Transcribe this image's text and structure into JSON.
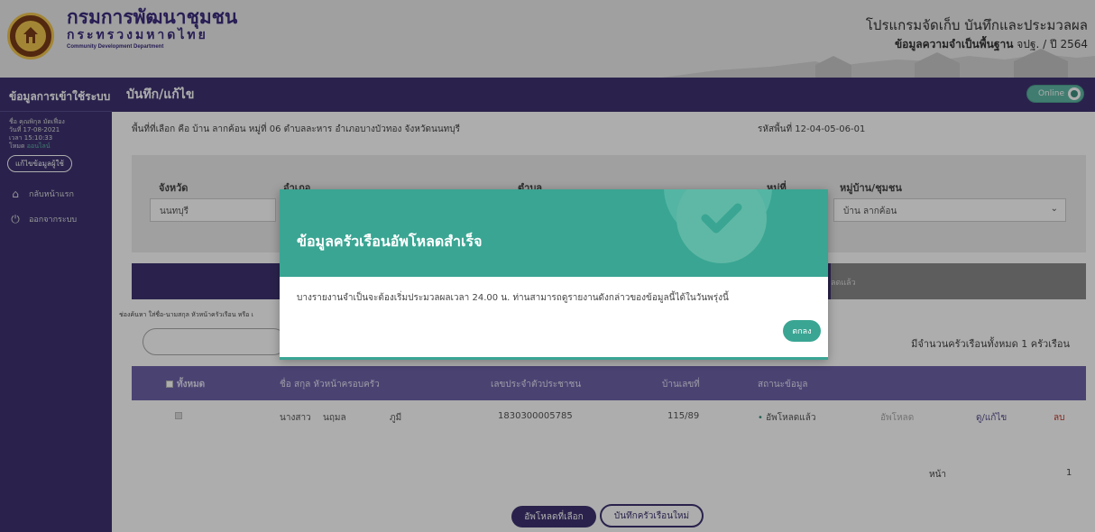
{
  "header": {
    "org_name_th": "กรมการพัฒนาชุมชน",
    "ministry_th": "กระทรวงมหาดไทย",
    "org_name_en": "Community Development Department",
    "program_title": "โปรแกรมจัดเก็บ บันทึกและประมวลผล",
    "program_sub_prefix": "ข้อมูลความจำเป็นพื้นฐาน",
    "program_sub_bold": "จปฐ. / ปี 2564"
  },
  "sidebar": {
    "title": "ข้อมูลการเข้าใช้ระบบ",
    "user_name": "ชื่อ คุณพิกุล มัดเฟื่อง",
    "user_date": "วันที่ 17-08-2021",
    "user_time": "เวลา 15:10:33",
    "mode_label": "โหมด",
    "mode_value": "ออนไลน์",
    "edit_profile": "แก้ไขข้อมูลผู้ใช้",
    "items": [
      {
        "label": "กลับหน้าแรก",
        "icon": "home-icon"
      },
      {
        "label": "ออกจากระบบ",
        "icon": "power-icon"
      }
    ]
  },
  "main": {
    "title": "บันทึก/แก้ไข",
    "online_label": "Online",
    "location_text": "พื้นที่ที่เลือก คือ บ้าน ลากค้อน หมู่ที่ 06 ตำบลละหาร อำเภอบางบัวทอง จังหวัดนนทบุรี",
    "area_code": "รหัสพื้นที่ 12-04-05-06-01"
  },
  "filters": {
    "province_label": "จังหวัด",
    "province_value": "นนทบุรี",
    "district_label": "อำเภอ",
    "subdistrict_label": "ตำบล",
    "village_no_label": "หมู่ที่",
    "village_label": "หมู่บ้าน/ชุมชน",
    "village_value": "บ้าน ลากค้อน"
  },
  "tabs": {
    "right_label": "ลดแล้ว"
  },
  "search": {
    "hint": "ช่องค้นหา ใส่ชื่อ-นามสกุล หัวหน้าครัวเรือน หรือ เ",
    "count_text": "มีจำนวนครัวเรือนทั้งหมด 1 ครัวเรือน"
  },
  "table": {
    "headers": {
      "select_all": "ทั้งหมด",
      "name": "ชื่อ สกุล หัวหน้าครอบครัว",
      "id_card": "เลขประจำตัวประชาชน",
      "house_no": "บ้านเลขที่",
      "status": "สถานะข้อมูล"
    },
    "rows": [
      {
        "title": "นางสาว",
        "first_name": "นฤมล",
        "last_name": "ภูมี",
        "id_card": "1830300005785",
        "house_no": "115/89",
        "status": "อัพโหลดแล้ว",
        "action_upload": "อัพโหลด",
        "action_view": "ดู/แก้ไข",
        "action_delete": "ลบ"
      }
    ]
  },
  "pagination": {
    "label": "หน้า",
    "current": "1"
  },
  "actions": {
    "upload_selected": "อัพโหลดที่เลือก",
    "new_household": "บันทึกครัวเรือนใหม่"
  },
  "modal": {
    "title": "ข้อมูลครัวเรือนอัพโหลดสำเร็จ",
    "body": "บางรายงานจำเป็นจะต้องเริ่มประมวลผลเวลา 24.00 น. ท่านสามารถดูรายงานดังกล่าวของข้อมูลนี้ได้ในวันพรุ่งนี้",
    "ok_label": "ตกลง"
  },
  "colors": {
    "primary": "#3e3370",
    "accent": "#3aa593",
    "table_header": "#6d64a8",
    "danger": "#c0392b"
  }
}
